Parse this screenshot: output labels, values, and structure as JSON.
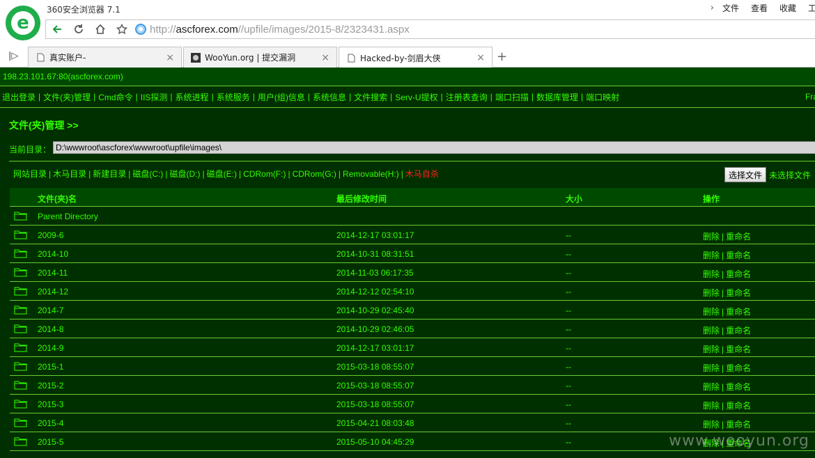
{
  "browser": {
    "app_title": "360安全浏览器 7.1",
    "menu": [
      "文件",
      "查看",
      "收藏",
      "工"
    ],
    "url_host": "ascforex.com",
    "url_scheme": "http://",
    "url_path": "//upfile/images/2015-8/2323431.aspx",
    "tabs": [
      {
        "label": "真实账户-"
      },
      {
        "label": "WooYun.org | 提交漏洞"
      },
      {
        "label": "Hacked-by-剑眉大侠"
      }
    ]
  },
  "shell": {
    "server": "198.23.101.67:80(ascforex.com)",
    "functions": [
      "退出登录",
      "文件(夹)管理",
      "Cmd命令",
      "IIS探测",
      "系统进程",
      "系统服务",
      "用户(组)信息",
      "系统信息",
      "文件搜索",
      "Serv-U提权",
      "注册表查询",
      "端口扫描",
      "数据库管理",
      "端口映射"
    ],
    "functions_tail": "Fra",
    "section_title": "文件(夹)管理 >>",
    "current_dir_label": "当前目录：",
    "current_dir": "D:\\wwwroot\\ascforex\\wwwroot\\upfile\\images\\",
    "links": [
      "网站目录",
      "木马目录",
      "新建目录",
      "磁盘(C:)",
      "磁盘(D:)",
      "磁盘(E:)",
      "CDRom(F:)",
      "CDRom(G:)",
      "Removable(H:)"
    ],
    "danger_link": "木马自杀",
    "upload_button": "选择文件",
    "upload_status": "未选择文件",
    "table_headers": [
      "文件(夹)名",
      "最后修改时间",
      "大小",
      "操作"
    ],
    "parent_directory": "Parent Directory",
    "rows": [
      {
        "name": "2009-6",
        "modified": "2014-12-17 03:01:17",
        "size": "--"
      },
      {
        "name": "2014-10",
        "modified": "2014-10-31 08:31:51",
        "size": "--"
      },
      {
        "name": "2014-11",
        "modified": "2014-11-03 06:17:35",
        "size": "--"
      },
      {
        "name": "2014-12",
        "modified": "2014-12-12 02:54:10",
        "size": "--"
      },
      {
        "name": "2014-7",
        "modified": "2014-10-29 02:45:40",
        "size": "--"
      },
      {
        "name": "2014-8",
        "modified": "2014-10-29 02:46:05",
        "size": "--"
      },
      {
        "name": "2014-9",
        "modified": "2014-12-17 03:01:17",
        "size": "--"
      },
      {
        "name": "2015-1",
        "modified": "2015-03-18 08:55:07",
        "size": "--"
      },
      {
        "name": "2015-2",
        "modified": "2015-03-18 08:55:07",
        "size": "--"
      },
      {
        "name": "2015-3",
        "modified": "2015-03-18 08:55:07",
        "size": "--"
      },
      {
        "name": "2015-4",
        "modified": "2015-04-21 08:03:48",
        "size": "--"
      },
      {
        "name": "2015-5",
        "modified": "2015-05-10 04:45:29",
        "size": "--"
      }
    ],
    "op_delete": "删除",
    "op_rename": "重命名"
  },
  "watermark": "www.wooyun.org",
  "colors": {
    "bg": "#003000",
    "bar": "#004a00",
    "text": "#33ff00",
    "danger": "#ff2222"
  }
}
